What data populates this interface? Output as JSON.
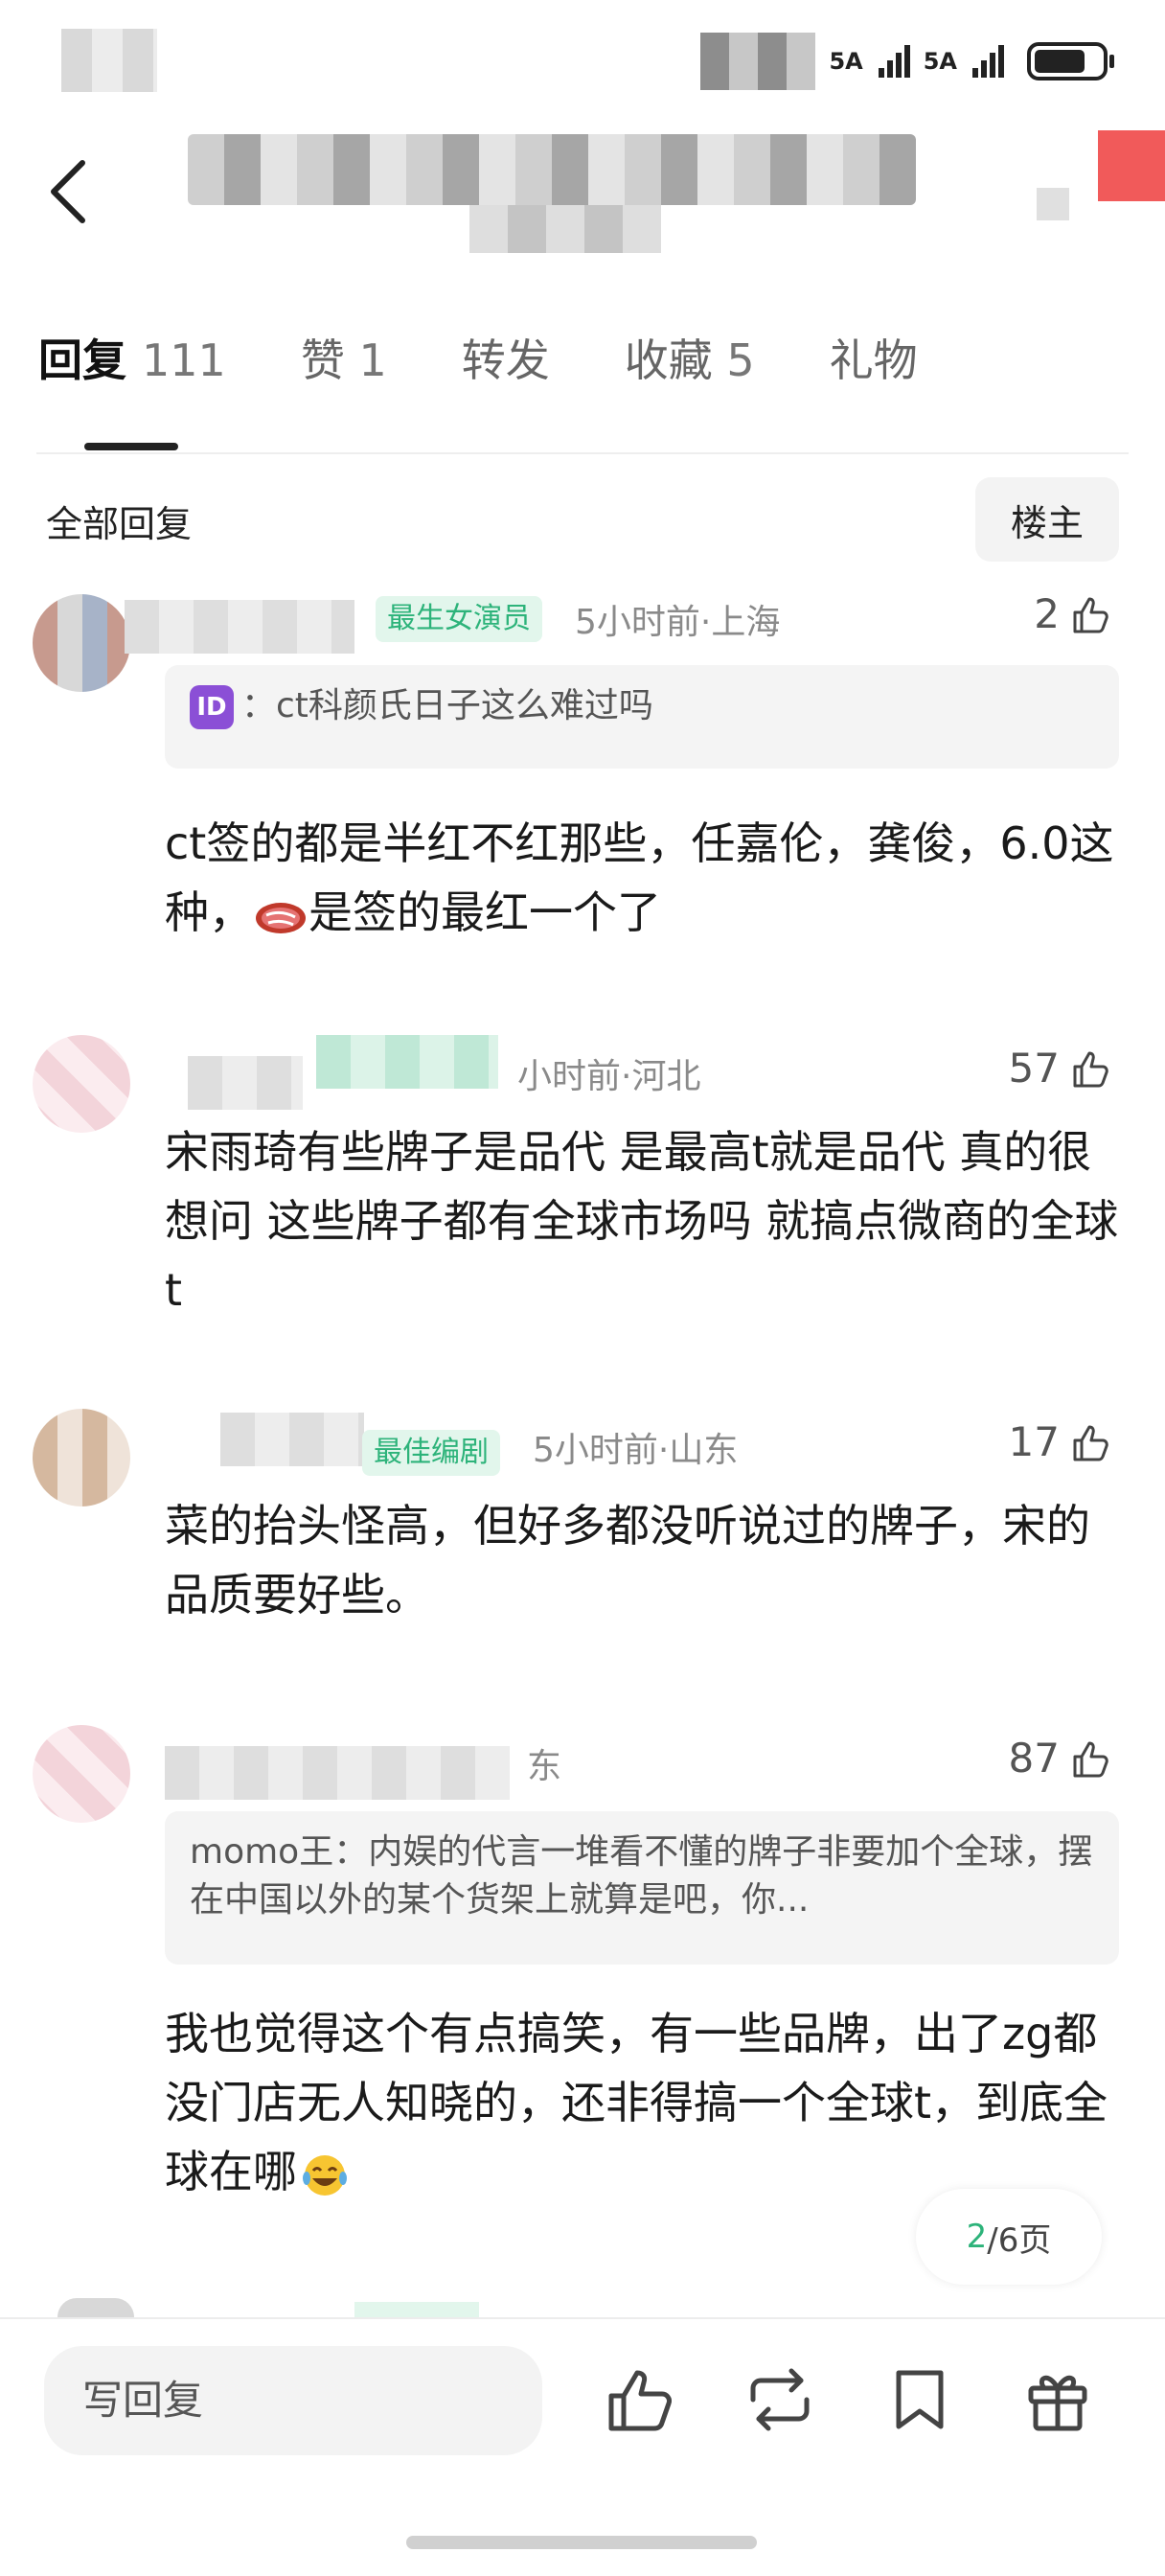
{
  "status_bar": {
    "signal1": "5A",
    "signal2": "5A"
  },
  "tabs": [
    {
      "label": "回复",
      "count": "111"
    },
    {
      "label": "赞",
      "count": "1"
    },
    {
      "label": "转发",
      "count": ""
    },
    {
      "label": "收藏",
      "count": "5"
    },
    {
      "label": "礼物",
      "count": ""
    }
  ],
  "replies_header": {
    "label": "全部回复",
    "filter": "楼主"
  },
  "comments": [
    {
      "badge": "最生女演员",
      "meta": "5小时前·上海",
      "likes": "2",
      "quote_label": "：",
      "quote_text": "ct科颜氏日子这么难过吗",
      "content": "ct签的都是半红不红那些，任嘉伦，龚俊，6.0这种，",
      "content_tail": "是签的最红一个了"
    },
    {
      "meta": "小时前·河北",
      "likes": "57",
      "content": "宋雨琦有些牌子是品代 是最高t就是品代 真的很想问 这些牌子都有全球市场吗 就搞点微商的全球t"
    },
    {
      "badge": "最佳编剧",
      "meta": "5小时前·山东",
      "likes": "17",
      "content": "菜的抬头怪高，但好多都没听说过的牌子，宋的品质要好些。"
    },
    {
      "meta": "东",
      "likes": "87",
      "quote_text": "momo王：内娱的代言一堆看不懂的牌子非要加个全球，摆在中国以外的某个货架上就算是吧，你...",
      "content": "我也觉得这个有点搞笑，有一些品牌，出了zg都没门店无人知晓的，还非得搞一个全球t，到底全球在哪"
    }
  ],
  "pager": {
    "current": "2",
    "total": "/6页"
  },
  "bottom_bar": {
    "reply_placeholder": "写回复"
  },
  "icons": {
    "back": "chevron-left-icon",
    "like": "thumbs-up-icon",
    "forward": "repost-icon",
    "favorite": "bookmark-icon",
    "gift": "gift-icon"
  },
  "colors": {
    "accent_green": "#2db37a",
    "badge_bg": "#e2f6ec",
    "id_badge": "#8b4fd6"
  }
}
